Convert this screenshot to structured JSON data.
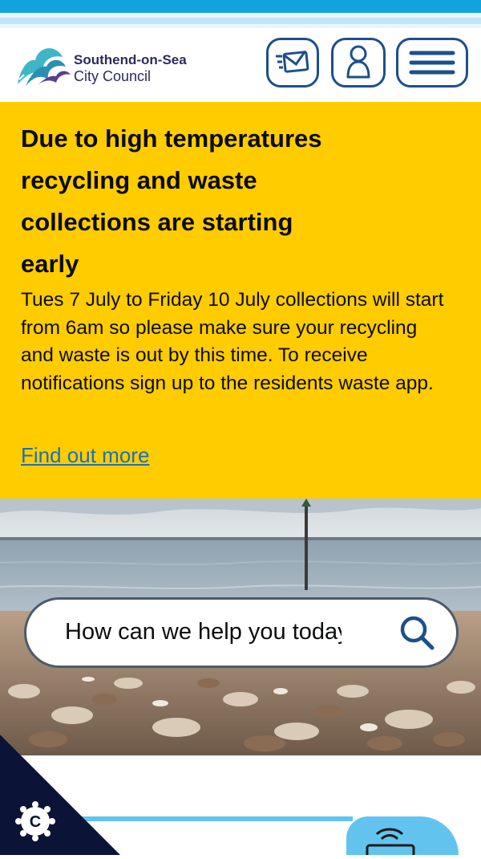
{
  "brand": {
    "name_line1": "Southend-on-Sea",
    "name_line2": "City Council",
    "navy": "#1d4f8c",
    "cyan": "#12a3dd"
  },
  "header": {
    "icons": [
      "mail-icon",
      "user-icon",
      "menu-icon"
    ]
  },
  "alert": {
    "heading": "Due to high temperatures recycling and waste collections are starting early",
    "body": "Tues 7 July to Friday 10 July collections will start from 6am so please make sure your recycling and waste is out by this time. To receive notifications sign up to the residents waste app.",
    "link": "Find out more",
    "background": "#ffcc00"
  },
  "search": {
    "placeholder": "How can we help you today?",
    "icon": "search-icon"
  },
  "cookie": {
    "icon": "cookie-settings-icon"
  }
}
